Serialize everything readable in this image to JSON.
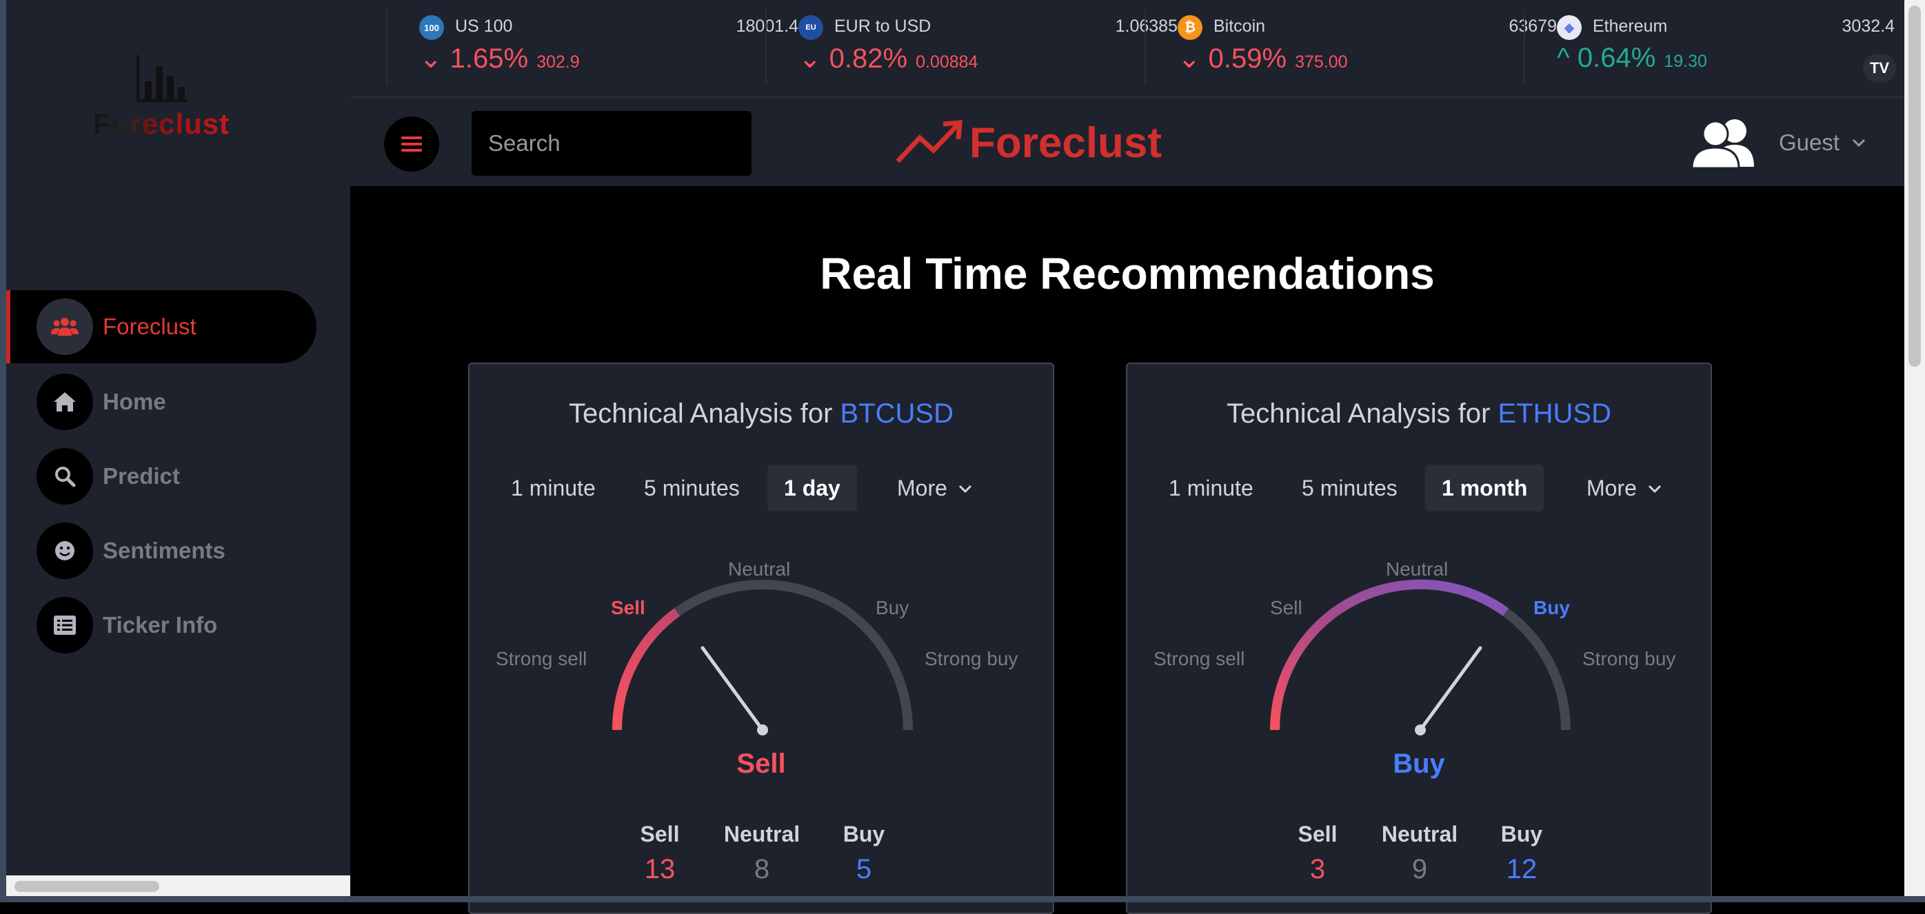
{
  "app": {
    "brand": "Foreclust"
  },
  "ticker": [
    {
      "name": "US 100",
      "logo": "100",
      "price": "18001.4",
      "change_pct": "1.65%",
      "change_abs": "302.9",
      "direction": "down"
    },
    {
      "name": "EUR to USD",
      "logo": "EU",
      "price": "1.06385",
      "change_pct": "0.82%",
      "change_abs": "0.00884",
      "direction": "down"
    },
    {
      "name": "Bitcoin",
      "logo": "₿",
      "price": "63679",
      "change_pct": "0.59%",
      "change_abs": "375.00",
      "direction": "down"
    },
    {
      "name": "Ethereum",
      "logo": "◆",
      "price": "3032.4",
      "change_pct": "0.64%",
      "change_abs": "19.30",
      "direction": "up"
    }
  ],
  "ticker_badge": "TV",
  "sidebar": {
    "logo_text": "Foreclust",
    "items": [
      {
        "label": "Foreclust",
        "icon": "users-icon",
        "active": true
      },
      {
        "label": "Home",
        "icon": "home-icon",
        "active": false
      },
      {
        "label": "Predict",
        "icon": "search-icon",
        "active": false
      },
      {
        "label": "Sentiments",
        "icon": "smiley-icon",
        "active": false
      },
      {
        "label": "Ticker Info",
        "icon": "list-icon",
        "active": false
      }
    ]
  },
  "header": {
    "search_placeholder": "Search",
    "brand": "Foreclust",
    "user": "Guest"
  },
  "main": {
    "title": "Real Time Recommendations",
    "cards": [
      {
        "title_prefix": "Technical Analysis for ",
        "symbol": "BTCUSD",
        "tabs": [
          "1 minute",
          "5 minutes",
          "1 day",
          "More"
        ],
        "active_tab": "1 day",
        "gauge_labels": {
          "strong_sell": "Strong sell",
          "sell": "Sell",
          "neutral": "Neutral",
          "buy": "Buy",
          "strong_buy": "Strong buy"
        },
        "highlighted": "sell",
        "verdict": "Sell",
        "counts": {
          "sell_label": "Sell",
          "sell": "13",
          "neutral_label": "Neutral",
          "neutral": "8",
          "buy_label": "Buy",
          "buy": "5"
        }
      },
      {
        "title_prefix": "Technical Analysis for ",
        "symbol": "ETHUSD",
        "tabs": [
          "1 minute",
          "5 minutes",
          "1 month",
          "More"
        ],
        "active_tab": "1 month",
        "gauge_labels": {
          "strong_sell": "Strong sell",
          "sell": "Sell",
          "neutral": "Neutral",
          "buy": "Buy",
          "strong_buy": "Strong buy"
        },
        "highlighted": "buy",
        "verdict": "Buy",
        "counts": {
          "sell_label": "Sell",
          "sell": "3",
          "neutral_label": "Neutral",
          "neutral": "9",
          "buy_label": "Buy",
          "buy": "12"
        }
      }
    ]
  },
  "colors": {
    "sell": "#f7525f",
    "buy": "#4a7dff",
    "accent": "#d32f2f",
    "up": "#22ab94"
  }
}
